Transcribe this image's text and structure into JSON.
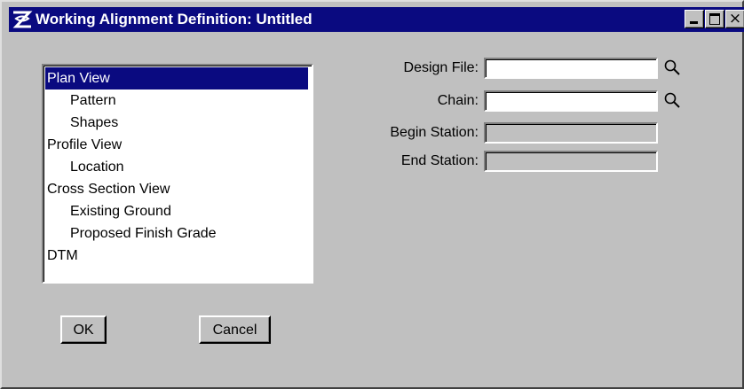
{
  "window": {
    "title": "Working Alignment Definition: Untitled",
    "close_glyph": "×",
    "titlebar_color": "#0a0a80",
    "icons": [
      "app-icon",
      "minimize-icon",
      "maximize-icon",
      "close-icon"
    ]
  },
  "view_list": {
    "items": [
      {
        "label": "Plan View",
        "level": 0,
        "selected": true
      },
      {
        "label": "Pattern",
        "level": 1
      },
      {
        "label": "Shapes",
        "level": 1
      },
      {
        "label": "Profile View",
        "level": 0
      },
      {
        "label": "Location",
        "level": 1
      },
      {
        "label": "Cross Section View",
        "level": 0
      },
      {
        "label": "Existing Ground",
        "level": 1
      },
      {
        "label": "Proposed Finish Grade",
        "level": 1
      },
      {
        "label": "DTM",
        "level": 0
      }
    ]
  },
  "form": {
    "design_file_label": "Design File:",
    "design_file_value": "",
    "chain_label": "Chain:",
    "chain_value": "",
    "begin_station_label": "Begin Station:",
    "begin_station_value": "",
    "end_station_label": "End Station:",
    "end_station_value": "",
    "search_icon": "magnifier-icon"
  },
  "buttons": {
    "ok_label": "OK",
    "cancel_label": "Cancel"
  }
}
